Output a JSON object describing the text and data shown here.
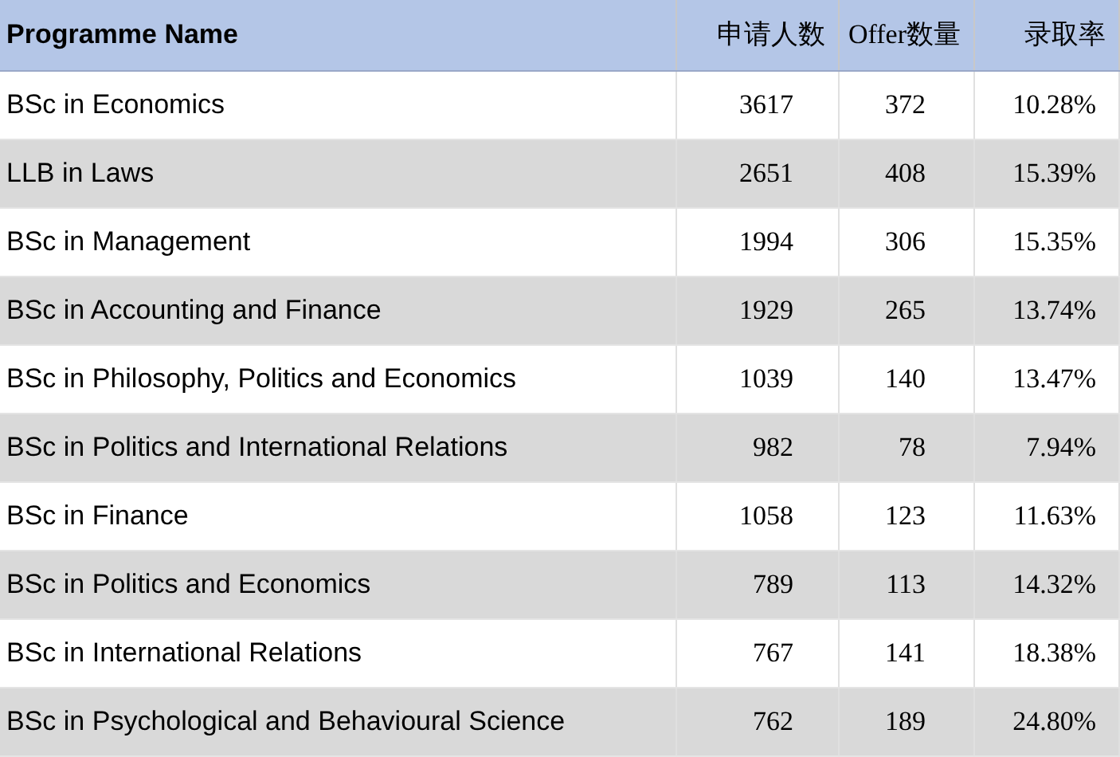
{
  "table": {
    "columns": [
      "Programme Name",
      "申请人数",
      "Offer数量",
      "录取率"
    ],
    "rows": [
      [
        "BSc in Economics",
        "3617",
        "372",
        "10.28%"
      ],
      [
        "LLB in Laws",
        "2651",
        "408",
        "15.39%"
      ],
      [
        "BSc in Management",
        "1994",
        "306",
        "15.35%"
      ],
      [
        "BSc in Accounting and Finance",
        "1929",
        "265",
        "13.74%"
      ],
      [
        "BSc in Philosophy, Politics and Economics",
        "1039",
        "140",
        "13.47%"
      ],
      [
        "BSc in Politics and International Relations",
        "982",
        "78",
        "7.94%"
      ],
      [
        "BSc in Finance",
        "1058",
        "123",
        "11.63%"
      ],
      [
        "BSc in Politics and Economics",
        "789",
        "113",
        "14.32%"
      ],
      [
        "BSc in International Relations",
        "767",
        "141",
        "18.38%"
      ],
      [
        "BSc in Psychological and Behavioural Science",
        "762",
        "189",
        "24.80%"
      ]
    ]
  }
}
